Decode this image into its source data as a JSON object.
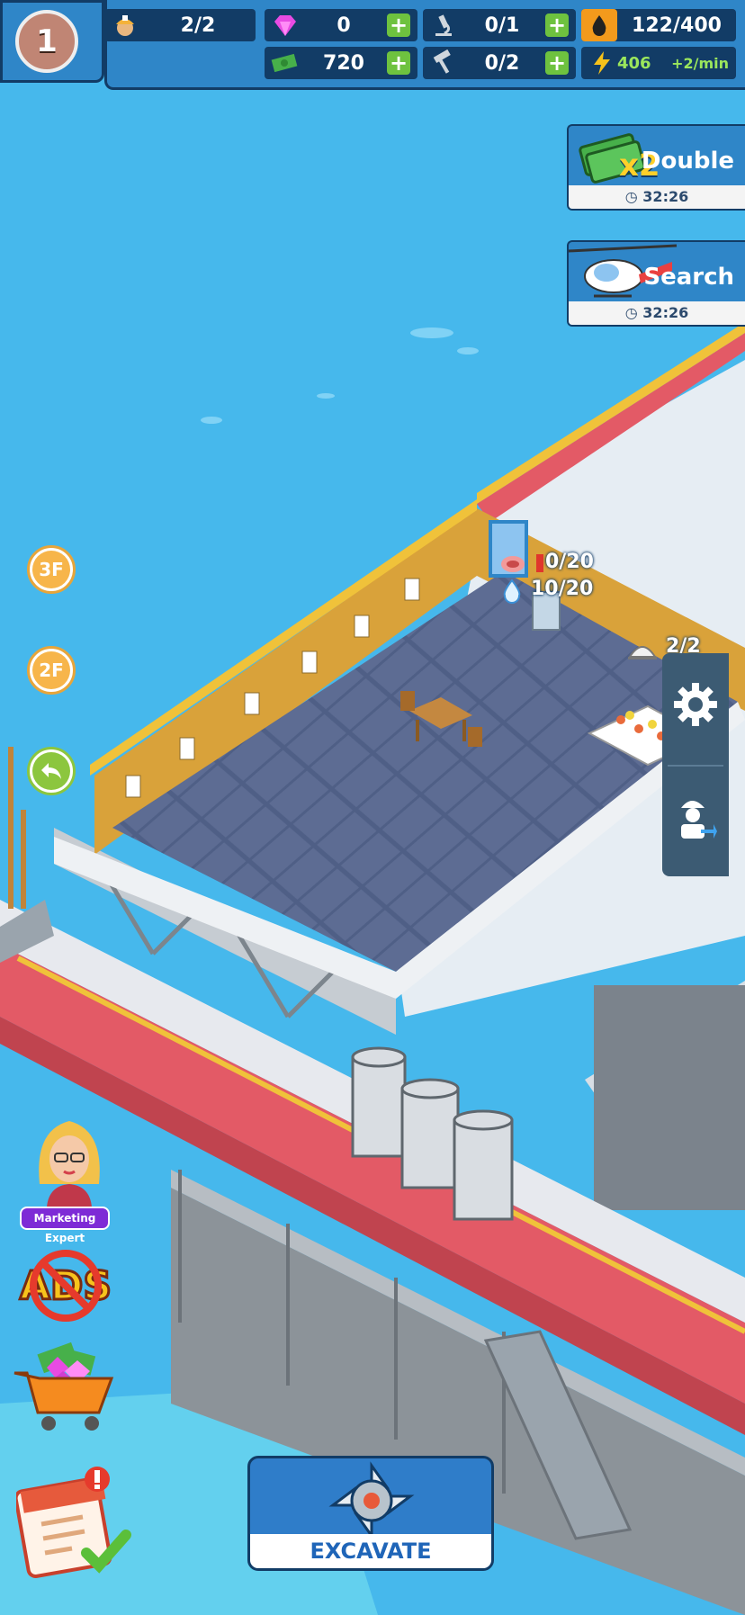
{
  "hud": {
    "level": "1",
    "workers": "2/2",
    "gems": "0",
    "research": "0/1",
    "oil": "122/400",
    "cash": "720",
    "tools": "0/2",
    "energy": "406",
    "energy_rate": "+2/min"
  },
  "offers": {
    "double": {
      "multiplier": "x2",
      "label": "Double",
      "timer": "32:26"
    },
    "search": {
      "label": "Search",
      "timer": "32:26"
    }
  },
  "floors": [
    "3F",
    "2F"
  ],
  "room": {
    "food": "0/20",
    "water": "10/20",
    "dishes": "2/2"
  },
  "left_menu": {
    "marketing_label": "Marketing Expert"
  },
  "excavate": {
    "label": "EXCAVATE"
  },
  "colors": {
    "sea": "#46b8ec",
    "hud": "#2f86c8",
    "hud_dark": "#123c66",
    "plus": "#6ec23f",
    "wall": "#d9a23a",
    "floor": "#4f5f86",
    "rail": "#e35a66"
  }
}
